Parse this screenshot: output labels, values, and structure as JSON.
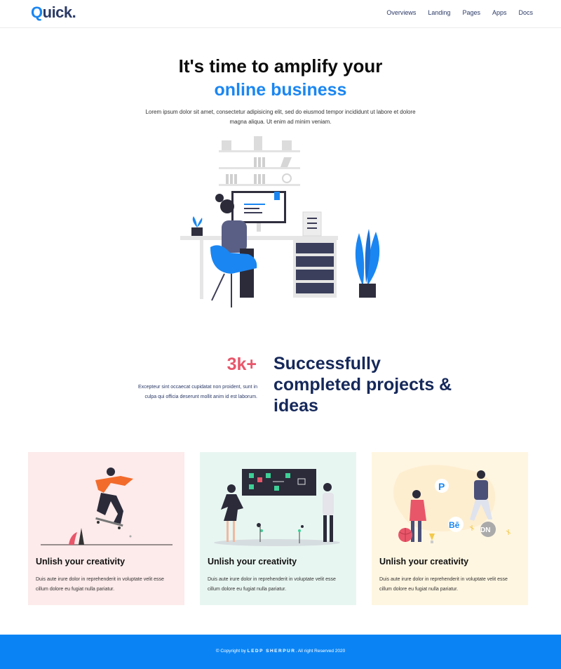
{
  "header": {
    "logo_q": "Q",
    "logo_rest": "uick.",
    "nav": [
      "Overviews",
      "Landing",
      "Pages",
      "Apps",
      "Docs"
    ]
  },
  "hero": {
    "title": "It's time to amplify your",
    "subtitle": "online business",
    "description": "Lorem ipsum dolor sit amet, consectetur adipisicing elit, sed do eiusmod tempor incididunt ut labore et dolore magna aliqua. Ut enim ad minim veniam.",
    "illustration": "woman-working-at-desk-illustration"
  },
  "stats": {
    "number": "3k+",
    "description": "Excepteur sint occaecat cupidatat non proident, sunt in culpa qui officia deserunt mollit anim id est laborum.",
    "headline": "Successfully completed projects & ideas"
  },
  "cards": [
    {
      "illustration": "skateboarder-illustration",
      "title": "Unlish your creativity",
      "text": "Duis aute irure dolor in reprehenderit in voluptate velit esse cillum dolore eu fugiat nulla pariatur."
    },
    {
      "illustration": "presentation-board-illustration",
      "title": "Unlish your creativity",
      "text": "Duis aute irure dolor in reprehenderit in voluptate velit esse cillum dolore eu fugiat nulla pariatur."
    },
    {
      "illustration": "social-icons-illustration",
      "title": "Unlish your creativity",
      "text": "Duis aute irure dolor in reprehenderit in voluptate velit esse cillum dolore eu fugiat nulla pariatur."
    }
  ],
  "footer": {
    "prefix": "© Copyright by",
    "brand": "LEDP SHERPUR",
    "suffix": ". All right Reserved 2020"
  },
  "colors": {
    "accent": "#1a86f2",
    "stat_red": "#e8566a",
    "navy": "#15285a",
    "footer_bg": "#0a84f5",
    "card_pink": "#fdeaea",
    "card_mint": "#e8f6f1",
    "card_cream": "#fff6e1"
  }
}
